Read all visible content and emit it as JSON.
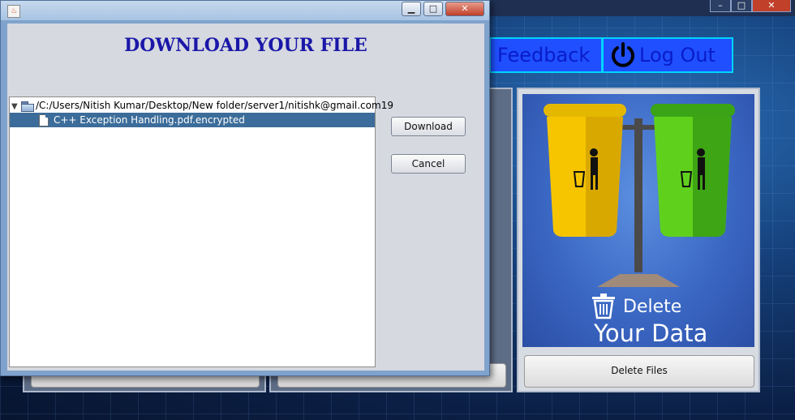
{
  "dialog": {
    "java_icon_glyph": "♨",
    "controls": {
      "minimize": "▁",
      "maximize": "□",
      "close": "✕"
    },
    "title": "DOWNLOAD YOUR FILE",
    "tree": {
      "root_path": "/C:/Users/Nitish Kumar/Desktop/New folder/server1/nitishk@gmail.com19",
      "toggle_glyph": "▼",
      "files": [
        "C++ Exception Handling.pdf.encrypted"
      ]
    },
    "buttons": {
      "download": "Download",
      "cancel": "Cancel"
    }
  },
  "background": {
    "window_controls": {
      "minimize": "–",
      "maximize": "□",
      "close": "✕"
    },
    "nav": {
      "feedback": "Feedback",
      "logout": "Log Out"
    },
    "card": {
      "caption_line1": "Delete",
      "caption_line2": "Your Data"
    },
    "delete_files_button": "Delete Files"
  },
  "colors": {
    "nav_bg": "#1f4fff",
    "nav_text": "#0a1cc9",
    "dialog_title": "#1a17a8",
    "selection": "#3c6d9a"
  }
}
